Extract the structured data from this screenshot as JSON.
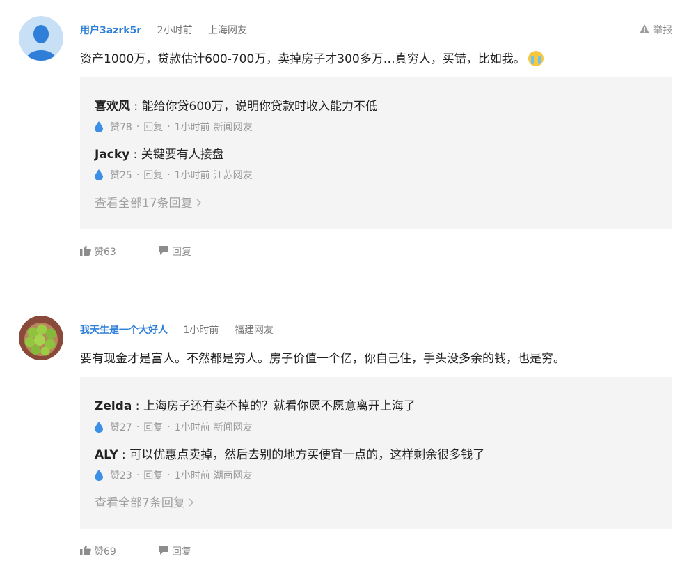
{
  "comments": [
    {
      "user": "用户3azrk5r",
      "time": "2小时前",
      "location": "上海网友",
      "report_label": "举报",
      "text": "资产1000万，贷款估计600-700万，卖掉房子才300多万…真穷人，买错，比如我。",
      "replies": [
        {
          "name": "喜欢风",
          "text": " : 能给你贷600万，说明你贷款时收入能力不低",
          "likes": "赞78",
          "reply_label": "回复",
          "time": "1小时前",
          "location": "新闻网友"
        },
        {
          "name": "Jacky",
          "text": " : 关键要有人接盘",
          "likes": "赞25",
          "reply_label": "回复",
          "time": "1小时前",
          "location": "江苏网友"
        }
      ],
      "more_replies": "查看全部17条回复",
      "like_label": "赞63",
      "reply_label": "回复"
    },
    {
      "user": "我天生是一个大好人",
      "time": "1小时前",
      "location": "福建网友",
      "text": "要有现金才是富人。不然都是穷人。房子价值一个亿，你自己住，手头没多余的钱，也是穷。",
      "replies": [
        {
          "name": "Zelda",
          "text": " : 上海房子还有卖不掉的？就看你愿不愿意离开上海了",
          "likes": "赞27",
          "reply_label": "回复",
          "time": "1小时前",
          "location": "新闻网友"
        },
        {
          "name": "ALY",
          "text": " : 可以优惠点卖掉，然后去别的地方买便宜一点的，这样剩余很多钱了",
          "likes": "赞23",
          "reply_label": "回复",
          "time": "1小时前",
          "location": "湖南网友"
        }
      ],
      "more_replies": "查看全部7条回复",
      "like_label": "赞69",
      "reply_label": "回复"
    }
  ],
  "colors": {
    "username": "#2f7fd8",
    "reply_box": "#f4f4f4",
    "drop_icon": "#3b8fe6"
  },
  "icons": [
    "default-avatar-icon",
    "warning-icon",
    "water-drop-icon",
    "thumbs-up-icon",
    "chat-bubble-icon",
    "chevron-right-icon",
    "crying-emoji-icon"
  ]
}
